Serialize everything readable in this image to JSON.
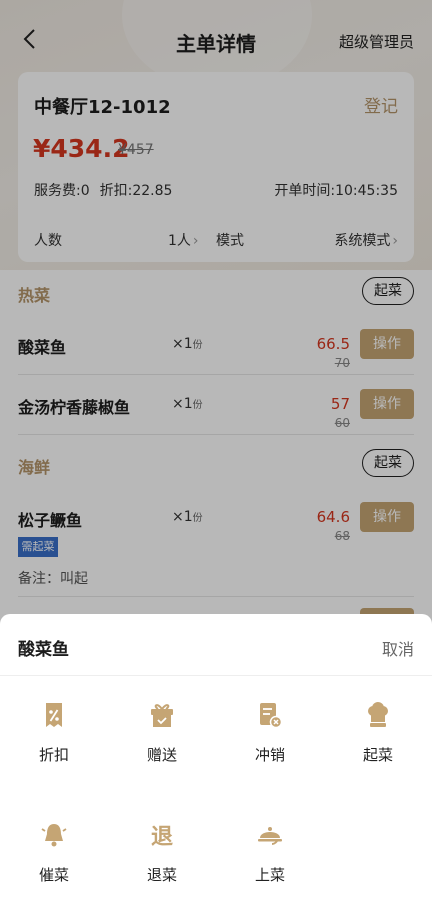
{
  "nav": {
    "title": "主单详情",
    "role": "超级管理员"
  },
  "order": {
    "name": "中餐厅12-1012",
    "register": "登记",
    "price_now": "¥434.2",
    "price_old": "¥457",
    "service_fee": "服务费:0",
    "discount": "折扣:22.85",
    "open_time": "开单时间:10:45:35",
    "people_label": "人数",
    "people_value": "1人",
    "mode_label": "模式",
    "mode_value": "系统模式"
  },
  "sections": [
    {
      "title": "热菜",
      "start_label": "起菜"
    },
    {
      "title": "海鲜",
      "start_label": "起菜"
    }
  ],
  "dishes": [
    {
      "name": "酸菜鱼",
      "qty": "×1",
      "unit": "份",
      "price": "66.5",
      "old_price": "70",
      "op": "操作"
    },
    {
      "name": "金汤柠香藤椒鱼",
      "qty": "×1",
      "unit": "份",
      "price": "57",
      "old_price": "60",
      "op": "操作"
    },
    {
      "name": "松子鳜鱼",
      "qty": "×1",
      "unit": "份",
      "price": "64.6",
      "old_price": "68",
      "op": "操作",
      "badge": "需起菜",
      "note": "备注：叫起"
    }
  ],
  "sheet": {
    "title": "酸菜鱼",
    "cancel": "取消",
    "actions": [
      {
        "label": "折扣",
        "icon": "discount-icon"
      },
      {
        "label": "赠送",
        "icon": "gift-icon"
      },
      {
        "label": "冲销",
        "icon": "write-off-icon"
      },
      {
        "label": "起菜",
        "icon": "chef-hat-icon"
      },
      {
        "label": "催菜",
        "icon": "bell-icon"
      },
      {
        "label": "退菜",
        "icon": "return-icon"
      },
      {
        "label": "上菜",
        "icon": "serve-cloche-icon"
      }
    ]
  },
  "colors": {
    "accent": "#c5a574",
    "price": "#d6361f",
    "badge": "#3a6fc9"
  }
}
